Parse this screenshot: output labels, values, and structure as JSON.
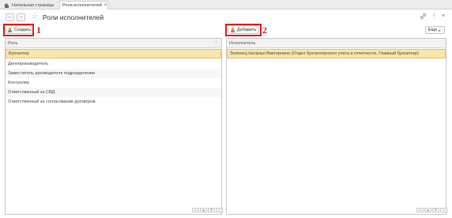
{
  "tabs": {
    "home_label": "Начальная страница",
    "active_label": "Роли исполнителей",
    "close_glyph": "×"
  },
  "header": {
    "title": "Роли исполнителей",
    "back_glyph": "←",
    "forward_glyph": "→",
    "star_glyph": "☆",
    "link_glyph": "🔗",
    "more_glyph": "⋮",
    "close_glyph": "×"
  },
  "left": {
    "create_label": "Создать",
    "annotation": "1",
    "column_header": "Роль",
    "sort_glyph": "↓",
    "rows": [
      "Бухгалтер",
      "Делопроизводитель",
      "Заместитель руководителя подразделения",
      "Контролер",
      "Ответственный за СВД",
      "Ответственный за согласование договоров"
    ]
  },
  "right": {
    "add_label": "Добавить",
    "annotation": "2",
    "more_label": "Еще",
    "more_caret": "▾",
    "column_header": "Исполнитель",
    "rows": [
      "Зеленец Наталья Викторовна (Отдел бухгалтерского учета и отчетности, Главный бухгалтер)"
    ]
  },
  "pager": {
    "first": "«",
    "prev": "▲",
    "next": "▼",
    "last": "»"
  },
  "colors": {
    "selection": "#f9e6a8",
    "annotation_red": "#d51c1c"
  }
}
